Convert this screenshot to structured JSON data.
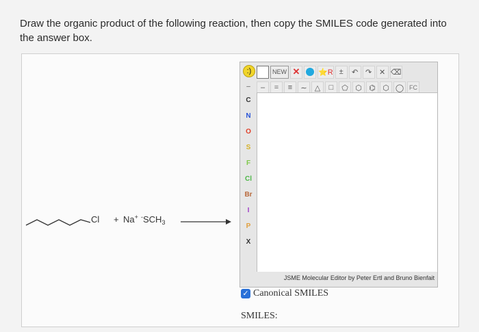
{
  "question": {
    "text": "Draw the organic product of the following reaction, then copy the SMILES code generated into the answer box."
  },
  "reaction": {
    "reactant_label": "Cl",
    "plus": "+",
    "reagent_na": "Na",
    "reagent_na_charge": "+",
    "reagent_anion_charge": "-",
    "reagent_anion": "SCH",
    "reagent_anion_subscript": "3"
  },
  "jsme": {
    "toolbar_row1": [
      "NEW",
      "✕",
      "",
      "⭐R",
      "±",
      "↶",
      "↷",
      "✕",
      "⌫"
    ],
    "toolbar_row2": [
      "–",
      "=",
      "≡",
      "∼",
      "△",
      "□",
      "⬠",
      "⬡",
      "⌬",
      "⬡",
      "◯",
      "FC"
    ],
    "smile_icon": ":)",
    "elements": [
      {
        "symbol": "C",
        "color": "#333333"
      },
      {
        "symbol": "N",
        "color": "#2a55d8"
      },
      {
        "symbol": "O",
        "color": "#e0402a"
      },
      {
        "symbol": "S",
        "color": "#d6b22a"
      },
      {
        "symbol": "F",
        "color": "#7fc84a"
      },
      {
        "symbol": "Cl",
        "color": "#4fb84a"
      },
      {
        "symbol": "Br",
        "color": "#b8683a"
      },
      {
        "symbol": "I",
        "color": "#a040c8"
      },
      {
        "symbol": "P",
        "color": "#e0a040"
      },
      {
        "symbol": "X",
        "color": "#333333"
      }
    ],
    "credit": "JSME Molecular Editor by Peter Ertl and Bruno Bienfait"
  },
  "canonical": {
    "label": "Canonical SMILES",
    "checked": true
  },
  "smiles": {
    "label": "SMILES:",
    "value": ""
  }
}
